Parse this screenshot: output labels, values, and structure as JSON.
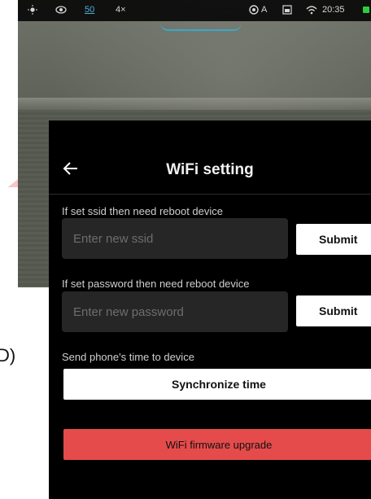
{
  "statusbar": {
    "sun_icon": "sun-icon",
    "eye_icon": "eye-icon",
    "mode_label": "50",
    "zoom": "4×",
    "auto_label": "A",
    "time": "20:35"
  },
  "side_char": "D)",
  "wifi_settings": {
    "title": "WiFi setting",
    "ssid": {
      "label": "If set ssid then need reboot device",
      "placeholder": "Enter new ssid",
      "submit_label": "Submit"
    },
    "password": {
      "label": "If set password then need reboot device",
      "placeholder": "Enter new password",
      "submit_label": "Submit"
    },
    "time_sync": {
      "label": "Send phone's time to device",
      "button_label": "Synchronize time"
    },
    "firmware": {
      "button_label": "WiFi firmware upgrade"
    }
  },
  "colors": {
    "panel_bg": "#000000",
    "field_bg": "#262626",
    "firmware_button": "#e54b4b",
    "status_accent": "#3aa7c9",
    "battery_green": "#2dcc3c"
  }
}
